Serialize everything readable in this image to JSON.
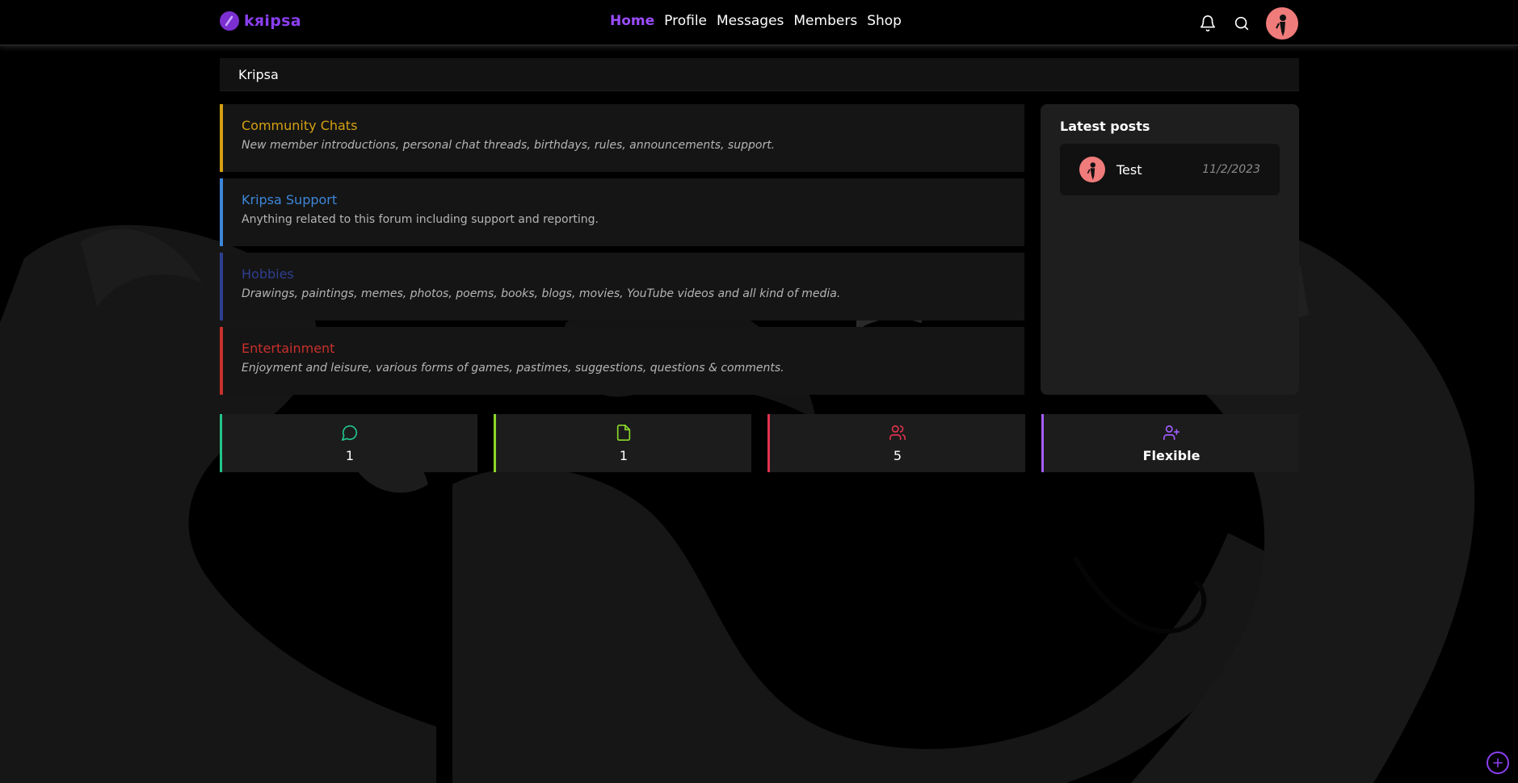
{
  "brand": {
    "name": "kяipsa",
    "color": "#8a3ff0"
  },
  "nav": {
    "items": [
      {
        "label": "Home",
        "active": true
      },
      {
        "label": "Profile"
      },
      {
        "label": "Messages"
      },
      {
        "label": "Members"
      },
      {
        "label": "Shop"
      }
    ]
  },
  "topbar": {
    "icons": [
      "bell-icon",
      "search-icon",
      "user-avatar"
    ]
  },
  "breadcrumb": {
    "title": "Kripsa"
  },
  "forums": [
    {
      "title": "Community Chats",
      "description": "New member introductions, personal chat threads, birthdays, rules, announcements, support.",
      "color": "#d4a012"
    },
    {
      "title": "Kripsa Support",
      "description": "Anything related to this forum including support and reporting.",
      "color": "#3d86d8"
    },
    {
      "title": "Hobbies",
      "description": "Drawings, paintings, memes, photos, poems, books, blogs, movies, YouTube videos and all kind of media.",
      "color": "#2e3f8f"
    },
    {
      "title": "Entertainment",
      "description": "Enjoyment and leisure, various forms of games, pastimes, suggestions, questions & comments.",
      "color": "#c9302c"
    }
  ],
  "latest_posts": {
    "heading": "Latest posts",
    "items": [
      {
        "title": "Test",
        "date": "11/2/2023"
      }
    ]
  },
  "stats": [
    {
      "icon": "chat-bubble-icon",
      "value": "1",
      "color": "#22c58b"
    },
    {
      "icon": "file-icon",
      "value": "1",
      "color": "#8bd82b"
    },
    {
      "icon": "users-icon",
      "value": "5",
      "color": "#e0334f"
    },
    {
      "icon": "user-plus-icon",
      "value": "Flexible",
      "color": "#a45dff"
    }
  ],
  "fab": {
    "icon": "plus-icon"
  }
}
